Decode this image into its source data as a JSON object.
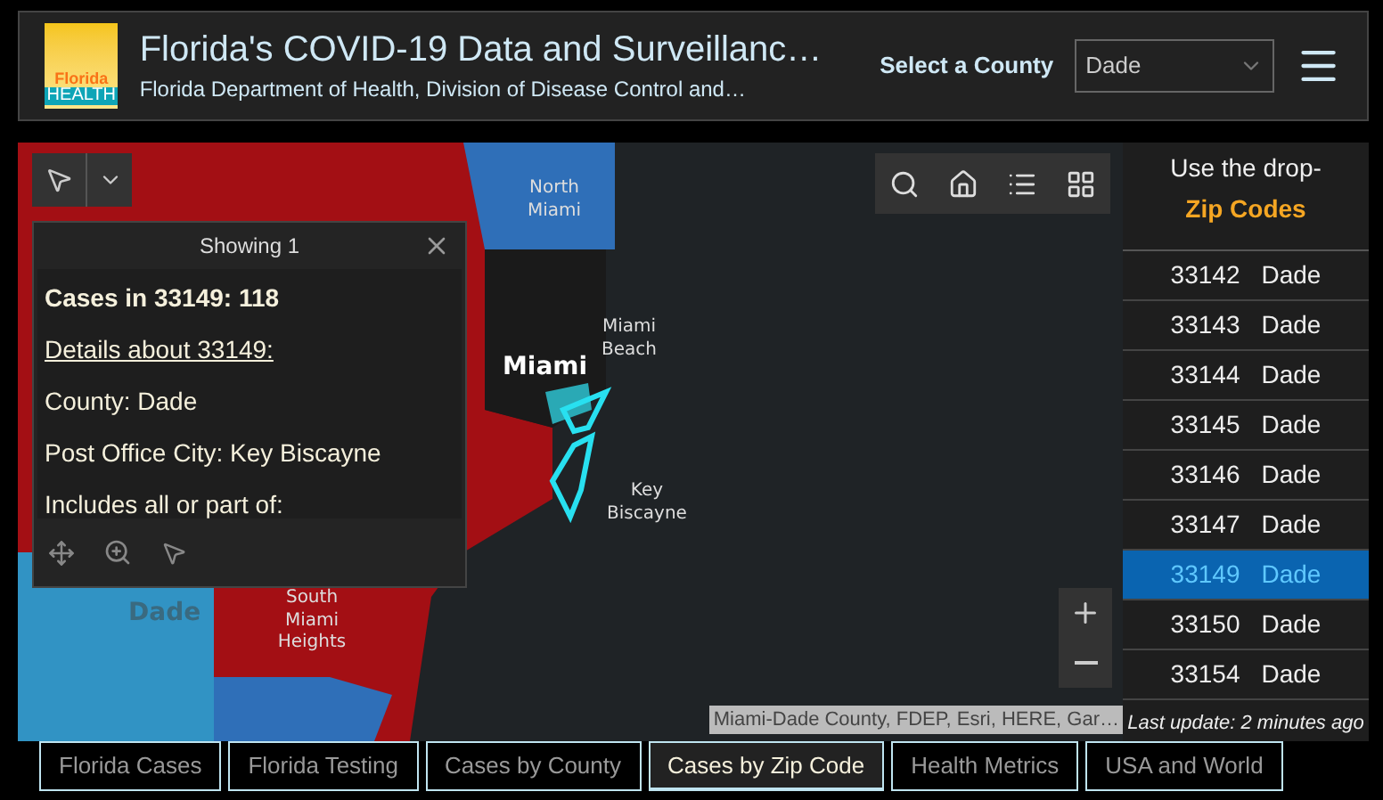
{
  "header": {
    "title": "Florida's COVID-19 Data and Surveillanc…",
    "subtitle": "Florida Department of Health, Division of Disease Control and…",
    "logo_lines": [
      "Florida",
      "HEALTH"
    ],
    "county_label": "Select a County",
    "county_value": "Dade"
  },
  "map": {
    "labels": [
      {
        "text": "North Miami",
        "kind": "place"
      },
      {
        "text": "Miami Beach",
        "kind": "place"
      },
      {
        "text": "Miami",
        "kind": "city"
      },
      {
        "text": "Key Biscayne",
        "kind": "place"
      },
      {
        "text": "South Miami Heights",
        "kind": "place"
      },
      {
        "text": "Dade",
        "kind": "county"
      }
    ],
    "attribution": "Miami-Dade County, FDEP, Esri, HERE, Gar…"
  },
  "popup": {
    "title": "Showing 1",
    "lines": [
      {
        "text": "Cases in 33149: 118",
        "kind": "bold"
      },
      {
        "text": "Details about 33149:",
        "kind": "link"
      },
      {
        "text": "County: Dade",
        "kind": "plain"
      },
      {
        "text": "Post Office City: Key Biscayne",
        "kind": "plain"
      },
      {
        "text": "Includes all or part of:",
        "kind": "plain"
      }
    ]
  },
  "list": {
    "intro": "Use the drop-",
    "heading": "Zip Codes",
    "rows": [
      {
        "zip": "33142",
        "county": "Dade",
        "selected": false
      },
      {
        "zip": "33143",
        "county": "Dade",
        "selected": false
      },
      {
        "zip": "33144",
        "county": "Dade",
        "selected": false
      },
      {
        "zip": "33145",
        "county": "Dade",
        "selected": false
      },
      {
        "zip": "33146",
        "county": "Dade",
        "selected": false
      },
      {
        "zip": "33147",
        "county": "Dade",
        "selected": false
      },
      {
        "zip": "33149",
        "county": "Dade",
        "selected": true
      },
      {
        "zip": "33150",
        "county": "Dade",
        "selected": false
      },
      {
        "zip": "33154",
        "county": "Dade",
        "selected": false
      }
    ],
    "footer": "Last update: 2 minutes ago"
  },
  "tabs": [
    {
      "label": "Florida Cases",
      "selected": false
    },
    {
      "label": "Florida Testing",
      "selected": false
    },
    {
      "label": "Cases by County",
      "selected": false
    },
    {
      "label": "Cases by Zip Code",
      "selected": true
    },
    {
      "label": "Health Metrics",
      "selected": false
    },
    {
      "label": "USA and World",
      "selected": false
    }
  ]
}
